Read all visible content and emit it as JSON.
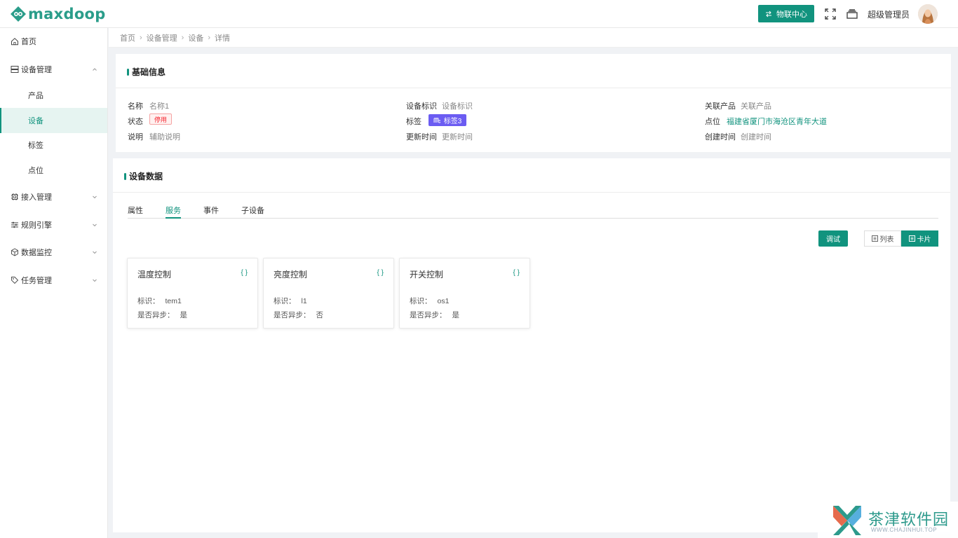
{
  "app": {
    "brand": "maxdoop",
    "brand_color": "#11937e"
  },
  "header": {
    "iot_center_label": "物联中心",
    "user_name": "超级管理员"
  },
  "sidebar": {
    "items": [
      {
        "label": "首页",
        "icon": "home-icon"
      },
      {
        "label": "设备管理",
        "icon": "server-icon",
        "expanded": true
      },
      {
        "label": "产品"
      },
      {
        "label": "设备",
        "active": true
      },
      {
        "label": "标签"
      },
      {
        "label": "点位"
      },
      {
        "label": "接入管理",
        "icon": "chip-icon"
      },
      {
        "label": "规则引擎",
        "icon": "sliders-icon"
      },
      {
        "label": "数据监控",
        "icon": "cube-icon"
      },
      {
        "label": "任务管理",
        "icon": "tag-icon"
      }
    ]
  },
  "breadcrumb": [
    "首页",
    "设备管理",
    "设备",
    "详情"
  ],
  "basic_info": {
    "title": "基础信息",
    "name_key": "名称",
    "name_val": "名称1",
    "status_key": "状态",
    "status_val": "停用",
    "desc_key": "说明",
    "desc_val": "辅助说明",
    "ident_key": "设备标识",
    "ident_val": "设备标识",
    "tag_key": "标签",
    "tag_val": "标签3",
    "updated_key": "更新时间",
    "updated_val": "更新时间",
    "product_key": "关联产品",
    "product_val": "关联产品",
    "point_key": "点位",
    "point_val": "福建省厦门市海沧区青年大道",
    "created_key": "创建时间",
    "created_val": "创建时间"
  },
  "device_data": {
    "title": "设备数据",
    "tabs": [
      "属性",
      "服务",
      "事件",
      "子设备"
    ],
    "active_tab": "服务",
    "debug_label": "调试",
    "list_label": "列表",
    "card_label": "卡片",
    "cards": [
      {
        "title": "温度控制",
        "brace": "{ }",
        "ident_key": "标识：",
        "ident": "tem1",
        "async_key": "是否异步：",
        "async": "是"
      },
      {
        "title": "亮度控制",
        "brace": "{ }",
        "ident_key": "标识：",
        "ident": "l1",
        "async_key": "是否异步：",
        "async": "否"
      },
      {
        "title": "开关控制",
        "brace": "{ }",
        "ident_key": "标识：",
        "ident": "os1",
        "async_key": "是否异步：",
        "async": "是"
      }
    ]
  },
  "watermark": {
    "text": "茶津软件园",
    "sub": "WWW.CHAJINHUI.TOP"
  }
}
